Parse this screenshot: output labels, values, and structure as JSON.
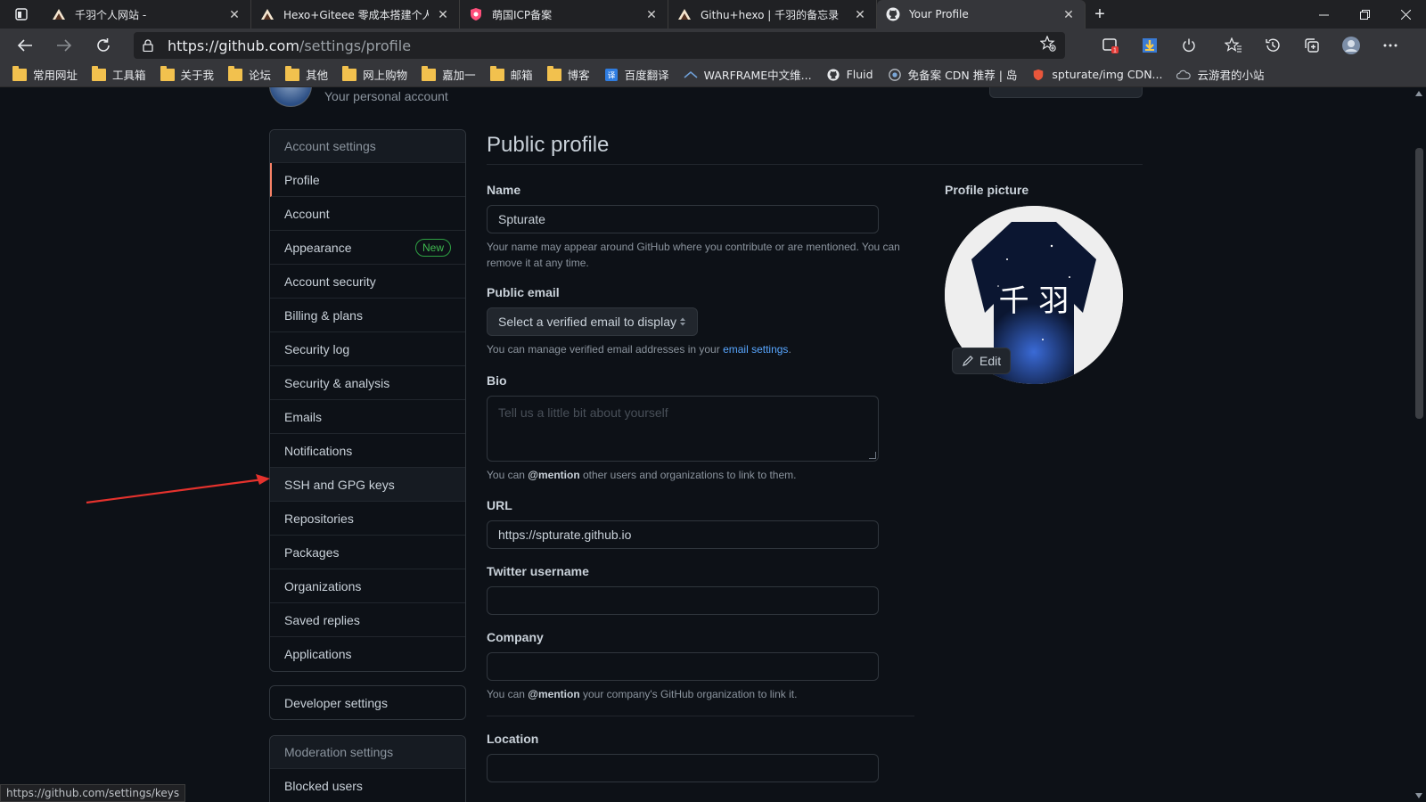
{
  "tabs": [
    {
      "title": "千羽个人网站 -",
      "icon": "site-favicon"
    },
    {
      "title": "Hexo+Giteee 零成本搭建个人静",
      "icon": "site-favicon"
    },
    {
      "title": "萌国ICP备案",
      "icon": "shield-favicon"
    },
    {
      "title": "Githu+hexo | 千羽的备忘录",
      "icon": "site-favicon"
    },
    {
      "title": "Your Profile",
      "icon": "github-favicon",
      "active": true
    }
  ],
  "address": {
    "host": "https://github.com",
    "path": "/settings/profile"
  },
  "bookmarks": [
    "常用网址",
    "工具箱",
    "关于我",
    "论坛",
    "其他",
    "网上购物",
    "嘉加一",
    "邮箱",
    "博客",
    "百度翻译",
    "WARFRAME中文维...",
    "Fluid",
    "免备案 CDN 推荐 | 岛",
    "spturate/img CDN...",
    "云游君的小站"
  ],
  "header": {
    "subtitle": "Your personal account"
  },
  "sidebar": {
    "heading": "Account settings",
    "items": [
      {
        "label": "Profile"
      },
      {
        "label": "Account"
      },
      {
        "label": "Appearance",
        "badge": "New"
      },
      {
        "label": "Account security"
      },
      {
        "label": "Billing & plans"
      },
      {
        "label": "Security log"
      },
      {
        "label": "Security & analysis"
      },
      {
        "label": "Emails"
      },
      {
        "label": "Notifications"
      },
      {
        "label": "SSH and GPG keys"
      },
      {
        "label": "Repositories"
      },
      {
        "label": "Packages"
      },
      {
        "label": "Organizations"
      },
      {
        "label": "Saved replies"
      },
      {
        "label": "Applications"
      }
    ],
    "developer": "Developer settings",
    "moderation_heading": "Moderation settings",
    "moderation_items": [
      "Blocked users"
    ]
  },
  "main": {
    "title": "Public profile",
    "name_label": "Name",
    "name_value": "Spturate",
    "name_note": "Your name may appear around GitHub where you contribute or are mentioned. You can remove it at any time.",
    "email_label": "Public email",
    "email_select": "Select a verified email to display",
    "email_note_pre": "You can manage verified email addresses in your",
    "email_note_link": "email settings",
    "email_note_post": ".",
    "bio_label": "Bio",
    "bio_placeholder": "Tell us a little bit about yourself",
    "bio_note_pre": "You can",
    "bio_note_mention": "@mention",
    "bio_note_post": "other users and organizations to link to them.",
    "url_label": "URL",
    "url_value": "https://spturate.github.io",
    "twitter_label": "Twitter username",
    "company_label": "Company",
    "company_note_pre": "You can",
    "company_note_mention": "@mention",
    "company_note_post": "your company's GitHub organization to link it.",
    "location_label": "Location",
    "picture_label": "Profile picture",
    "edit_label": "Edit",
    "picture_text": "千 羽"
  },
  "status_url": "https://github.com/settings/keys",
  "colors": {
    "accent": "#f78166",
    "link": "#58a6ff",
    "badge": "#3fb950",
    "arrow": "#e5322d"
  }
}
